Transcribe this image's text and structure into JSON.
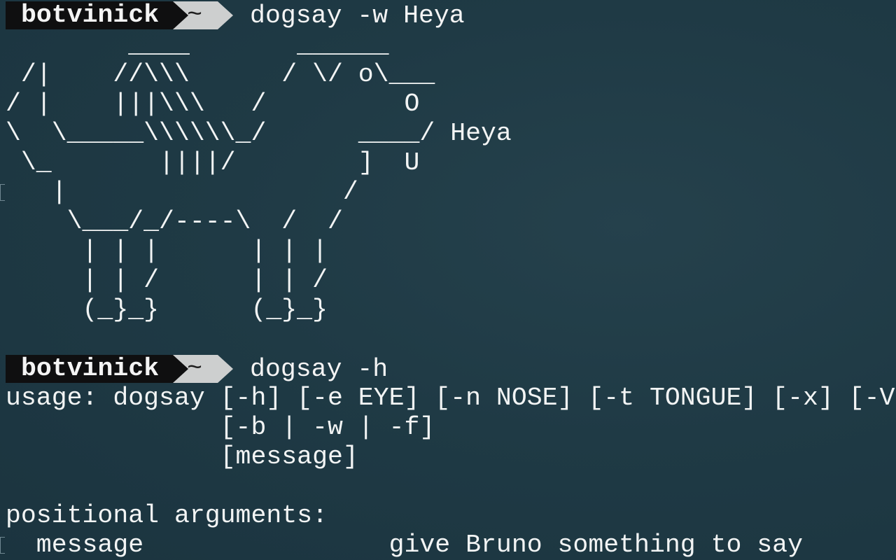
{
  "prompt": {
    "user": "botvinick",
    "dir": "~"
  },
  "commands": [
    "dogsay -w Heya",
    "dogsay -h"
  ],
  "dog_art": "        ____       ______\n /|    //\\\\\\      / \\/ o\\___\n/ |    |||\\\\\\   /         O\n\\  \\_____\\\\\\\\\\\\_/      ____/ Heya\n \\_       ||||/        ]  U\n   |                  /\n    \\___/_/----\\  /  /\n     | | |      | | |\n     | | /      | | /\n     (_}_}      (_}_}",
  "help": {
    "usage_1": "usage: dogsay [-h] [-e EYE] [-n NOSE] [-t TONGUE] [-x] [-V",
    "usage_2": "              [-b | -w | -f]",
    "usage_3": "              [message]",
    "positional_header": "positional arguments:",
    "positional_message": "  message                give Bruno something to say"
  }
}
